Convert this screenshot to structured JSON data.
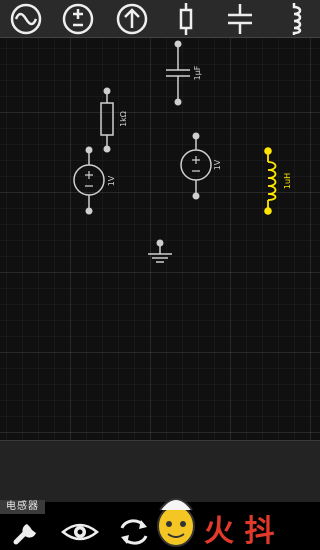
{
  "toolbar": {
    "tools": [
      {
        "name": "ac-source-tool",
        "icon": "sine-wave-icon"
      },
      {
        "name": "dc-source-tool",
        "icon": "plus-minus-circle-icon"
      },
      {
        "name": "current-source-tool",
        "icon": "arrow-up-circle-icon"
      },
      {
        "name": "resistor-tool",
        "icon": "resistor-icon"
      },
      {
        "name": "capacitor-tool",
        "icon": "capacitor-icon"
      },
      {
        "name": "inductor-tool",
        "icon": "inductor-icon"
      }
    ]
  },
  "circuit": {
    "capacitor_value": "1μF",
    "resistor_value": "1kΩ",
    "source_left_value": "1V",
    "source_right_value": "1V",
    "inductor_value": "1uH",
    "selected_color": "#ffe600",
    "wire_color": "#cfcfcf"
  },
  "status": {
    "selected_component_label": "电感器"
  },
  "bottom_bar": {
    "tools": [
      {
        "name": "wrench-tool",
        "icon": "wrench-icon"
      },
      {
        "name": "view-tool",
        "icon": "eye-icon"
      },
      {
        "name": "rotate-tool",
        "icon": "rotate-arrows-icon"
      }
    ],
    "watermark_text": "火 抖"
  }
}
